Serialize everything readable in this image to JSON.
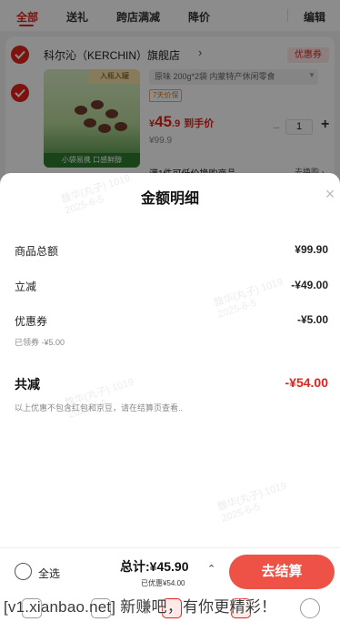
{
  "tabs": {
    "all": "全部",
    "gift": "送礼",
    "cross_store": "跨店满减",
    "price_drop": "降价",
    "edit": "编辑"
  },
  "cart": {
    "shop_name": "科尔沁（KERCHIN）旗舰店",
    "shop_arrow": "›",
    "coupon_chip": "优惠券",
    "product": {
      "image_tag": "入瓶入罐",
      "image_slogan": "小袋易携 口感鲜醇",
      "spec": "原味 200g*2袋 内蒙特产休闲零食",
      "return_tag": "7天价保",
      "price_currency": "¥",
      "price_int": "45",
      "price_dec": ".9",
      "price_hint": "到手价",
      "original_price": "¥99.9",
      "qty_minus": "−",
      "quantity": "1",
      "qty_plus": "+"
    },
    "promo_text": "满1件可低价换购商品",
    "promo_link": "去换购 ›"
  },
  "sheet": {
    "title": "金额明细",
    "close_icon": "×",
    "rows": [
      {
        "label": "商品总额",
        "value": "¥99.90"
      },
      {
        "label": "立减",
        "value": "-¥49.00"
      },
      {
        "label": "优惠券",
        "value": "-¥5.00",
        "sub": "已领券 -¥5.00"
      }
    ],
    "total_label": "共减",
    "total_value": "-¥54.00",
    "total_note": "以上优惠不包含红包和京豆，请在结算页查看..",
    "watermarks": [
      {
        "line1": "馥华(丸子) 1019",
        "line2": "2025-6-5"
      },
      {
        "line1": "馥华(丸子) 1019",
        "line2": "2025-6-5"
      },
      {
        "line1": "馥华(丸子) 1019",
        "line2": "2025-6-5"
      },
      {
        "line1": "馥华(丸子) 1019",
        "line2": "2025-6-5"
      }
    ]
  },
  "checkout": {
    "select_all": "全选",
    "total": "总计:¥45.90",
    "total_caret": "⌃",
    "discount_note": "已优惠¥54.00",
    "button": "去结算"
  },
  "forum_watermark": "[v1.xianbao.net] 新赚吧，有你更精彩！",
  "colors": {
    "accent": "#e2231a",
    "checkout_button": "#ee5246",
    "overlay": "rgba(0,0,0,0.45)"
  }
}
